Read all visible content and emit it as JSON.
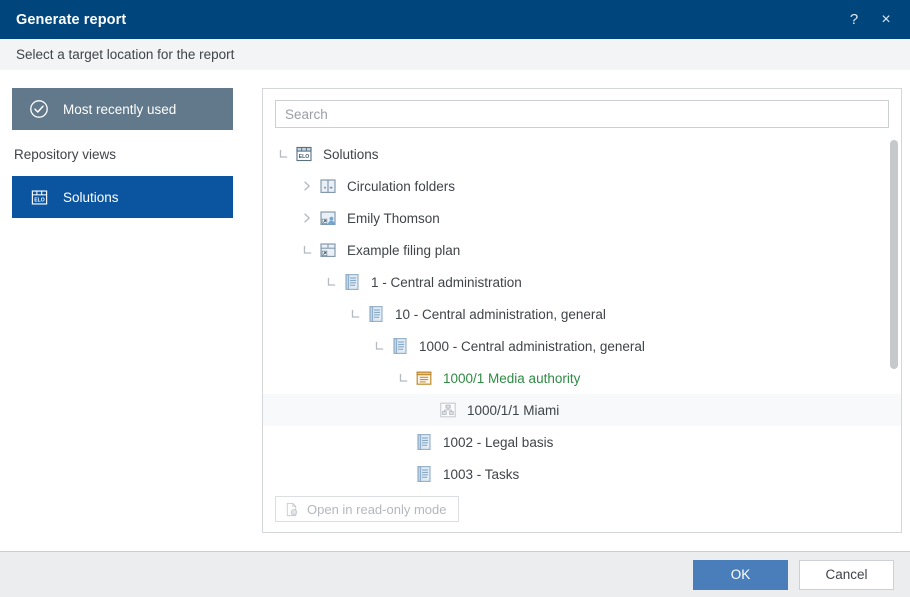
{
  "window": {
    "title": "Generate report",
    "help_icon": "help-icon",
    "close_icon": "close-icon",
    "help_glyph": "?",
    "close_glyph": "×",
    "accent_color": "#00457C"
  },
  "subtitle": {
    "text": "Select a target location for the report"
  },
  "sidebar": {
    "most_recently_used": {
      "label": "Most recently used",
      "icon": "check-circle-icon",
      "background": "#61798a"
    },
    "group_label": "Repository views",
    "views": [
      {
        "label": "Solutions",
        "icon": "elo-archive-icon",
        "selected": true,
        "background": "#0a54a0"
      }
    ]
  },
  "panel": {
    "search": {
      "placeholder": "Search",
      "value": ""
    },
    "tree": [
      {
        "label": "Solutions",
        "depth": 0,
        "state": "expanded",
        "icon": "elo-archive-icon",
        "selected": false,
        "color": "default"
      },
      {
        "label": "Circulation folders",
        "depth": 1,
        "state": "collapsed",
        "icon": "folder-box-icon",
        "selected": false,
        "color": "default"
      },
      {
        "label": "Emily Thomson",
        "depth": 1,
        "state": "collapsed",
        "icon": "user-folder-icon",
        "selected": false,
        "color": "default"
      },
      {
        "label": "Example filing plan",
        "depth": 1,
        "state": "expanded",
        "icon": "filing-plan-icon",
        "selected": false,
        "color": "default"
      },
      {
        "label": "1 - Central administration",
        "depth": 2,
        "state": "expanded",
        "icon": "register-icon",
        "selected": false,
        "color": "default"
      },
      {
        "label": "10 - Central administration, general",
        "depth": 3,
        "state": "expanded",
        "icon": "register-icon",
        "selected": false,
        "color": "default"
      },
      {
        "label": "1000 - Central administration, general",
        "depth": 4,
        "state": "expanded",
        "icon": "register-icon",
        "selected": false,
        "color": "default"
      },
      {
        "label": "1000/1 Media authority",
        "depth": 5,
        "state": "expanded",
        "icon": "folder-orange-icon",
        "selected": false,
        "color": "green"
      },
      {
        "label": "1000/1/1 Miami",
        "depth": 6,
        "state": "leaf",
        "icon": "hierarchy-icon",
        "selected": true,
        "color": "default"
      },
      {
        "label": "1002 - Legal basis",
        "depth": 5,
        "state": "leaf",
        "icon": "register-icon",
        "selected": false,
        "color": "default"
      },
      {
        "label": "1003 - Tasks",
        "depth": 5,
        "state": "leaf",
        "icon": "register-icon",
        "selected": false,
        "color": "default"
      }
    ],
    "read_only_button": {
      "label": "Open in read-only mode",
      "icon": "document-lock-icon",
      "disabled": true
    },
    "scrollbar": {
      "thumb_top_pct": 1,
      "thumb_height_pct": 55
    }
  },
  "footer": {
    "ok_label": "OK",
    "cancel_label": "Cancel",
    "ok_color": "#4a7ebb"
  }
}
